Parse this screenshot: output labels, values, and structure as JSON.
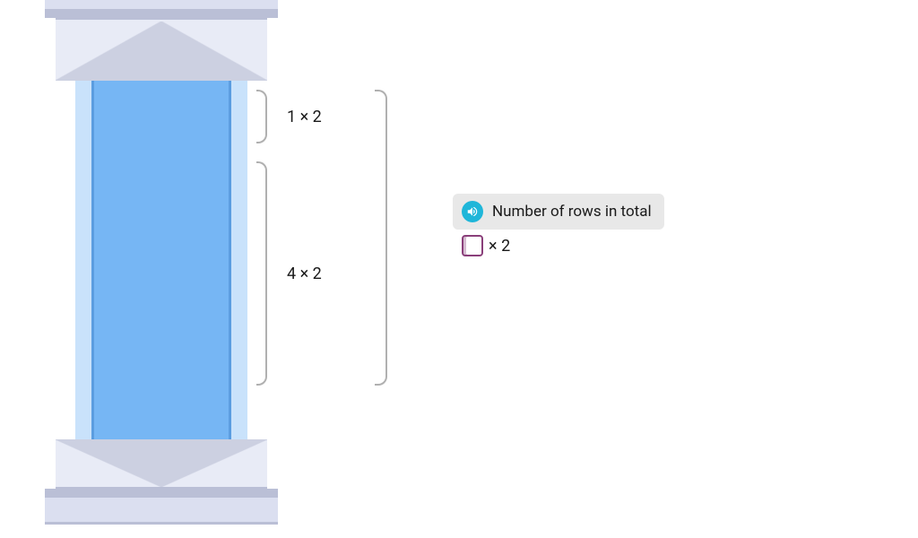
{
  "brackets": {
    "top_label": "1 × 2",
    "bottom_label": "4 × 2"
  },
  "prompt": {
    "text": "Number of rows in total",
    "icon": "audio-icon"
  },
  "answer": {
    "suffix": "× 2"
  },
  "colors": {
    "pillar_blue": "#76b6f4",
    "pillar_light": "#c9e2fb",
    "stone_base": "#dbdff0",
    "stone_shadow": "#9aa0bc",
    "bracket": "#b0b0b0",
    "audio_bg": "#1fb6d9",
    "answer_border": "#8a3f7a"
  }
}
